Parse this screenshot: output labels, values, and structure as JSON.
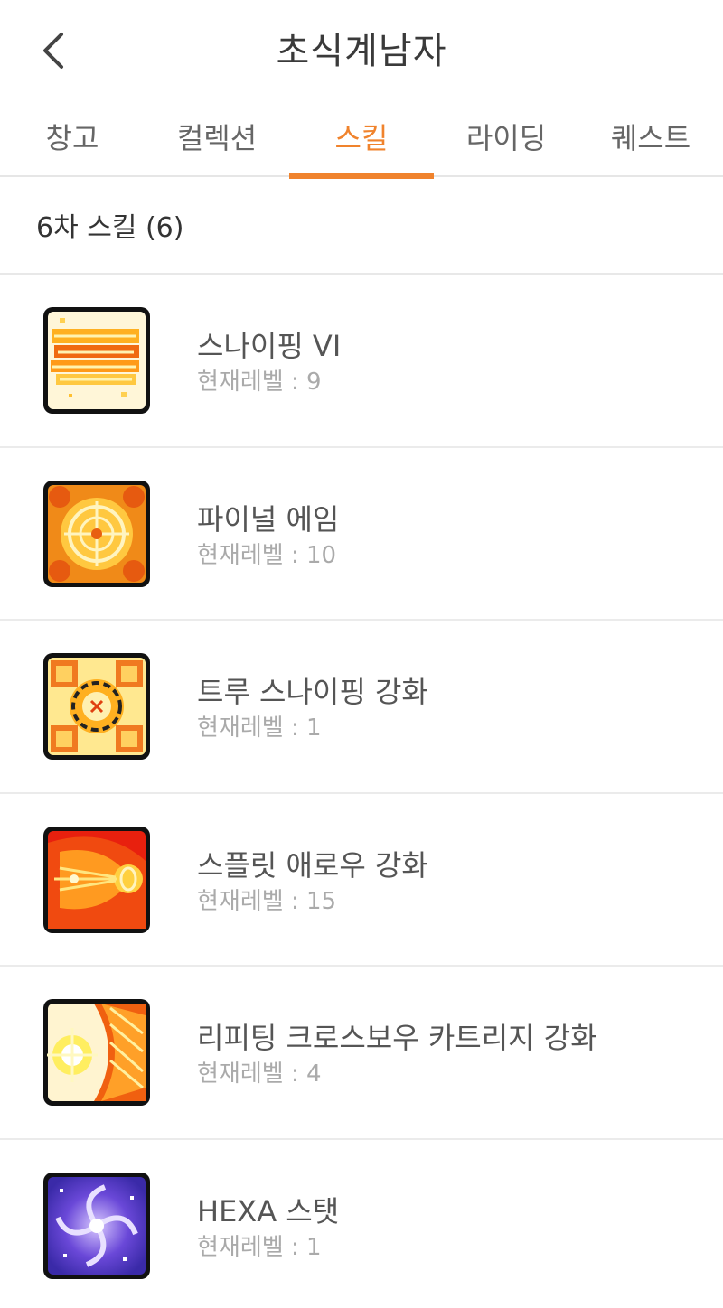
{
  "header": {
    "title": "초식계남자",
    "back_icon": "chevron-left-icon"
  },
  "tabs": [
    {
      "label": "창고",
      "active": false
    },
    {
      "label": "컬렉션",
      "active": false
    },
    {
      "label": "스킬",
      "active": true
    },
    {
      "label": "라이딩",
      "active": false
    },
    {
      "label": "퀘스트",
      "active": false
    }
  ],
  "accent_color": "#f0832d",
  "section": {
    "title": "6차 스킬 (6)"
  },
  "skills": [
    {
      "name": "스나이핑 VI",
      "level": "현재레벨 : 9",
      "icon": "sniping-skill-icon"
    },
    {
      "name": "파이널 에임",
      "level": "현재레벨 : 10",
      "icon": "final-aim-skill-icon"
    },
    {
      "name": "트루 스나이핑 강화",
      "level": "현재레벨 : 1",
      "icon": "true-sniping-skill-icon"
    },
    {
      "name": "스플릿 애로우 강화",
      "level": "현재레벨 : 15",
      "icon": "split-arrow-skill-icon"
    },
    {
      "name": "리피팅 크로스보우 카트리지 강화",
      "level": "현재레벨 : 4",
      "icon": "repeating-crossbow-skill-icon"
    },
    {
      "name": "HEXA 스탯",
      "level": "현재레벨 : 1",
      "icon": "hexa-stat-icon"
    }
  ]
}
